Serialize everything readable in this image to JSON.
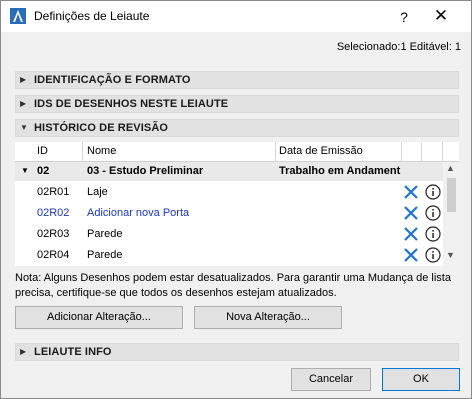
{
  "window": {
    "title": "Definições de Leiaute",
    "help_label": "?",
    "close_label": "✕"
  },
  "selection_info": "Selecionado:1 Editável: 1",
  "sections": {
    "identificacao": "IDENTIFICAÇÃO E FORMATO",
    "ids_desenhos": "IDS DE DESENHOS NESTE LEIAUTE",
    "historico": "HISTÓRICO DE REVISÃO",
    "leiaute_info": "LEIAUTE INFO"
  },
  "table": {
    "headers": {
      "id": "ID",
      "nome": "Nome",
      "data": "Data de Emissão"
    },
    "group": {
      "id": "02",
      "nome": "03 - Estudo Preliminar",
      "data": "Trabalho em Andament"
    },
    "rows": [
      {
        "id": "02R01",
        "nome": "Laje"
      },
      {
        "id": "02R02",
        "nome": "Adicionar nova Porta"
      },
      {
        "id": "02R03",
        "nome": "Parede"
      },
      {
        "id": "02R04",
        "nome": "Parede"
      }
    ]
  },
  "note": "Nota: Alguns Desenhos podem estar desatualizados. Para garantir uma Mudança de lista precisa, certifique-se que todos os desenhos estejam atualizados.",
  "buttons": {
    "adicionar": "Adicionar Alteração...",
    "nova": "Nova Alteração...",
    "cancelar": "Cancelar",
    "ok": "OK"
  },
  "colors": {
    "link": "#1a35c8",
    "icon_blue": "#1e73d2",
    "ok_border": "#0078d7"
  }
}
